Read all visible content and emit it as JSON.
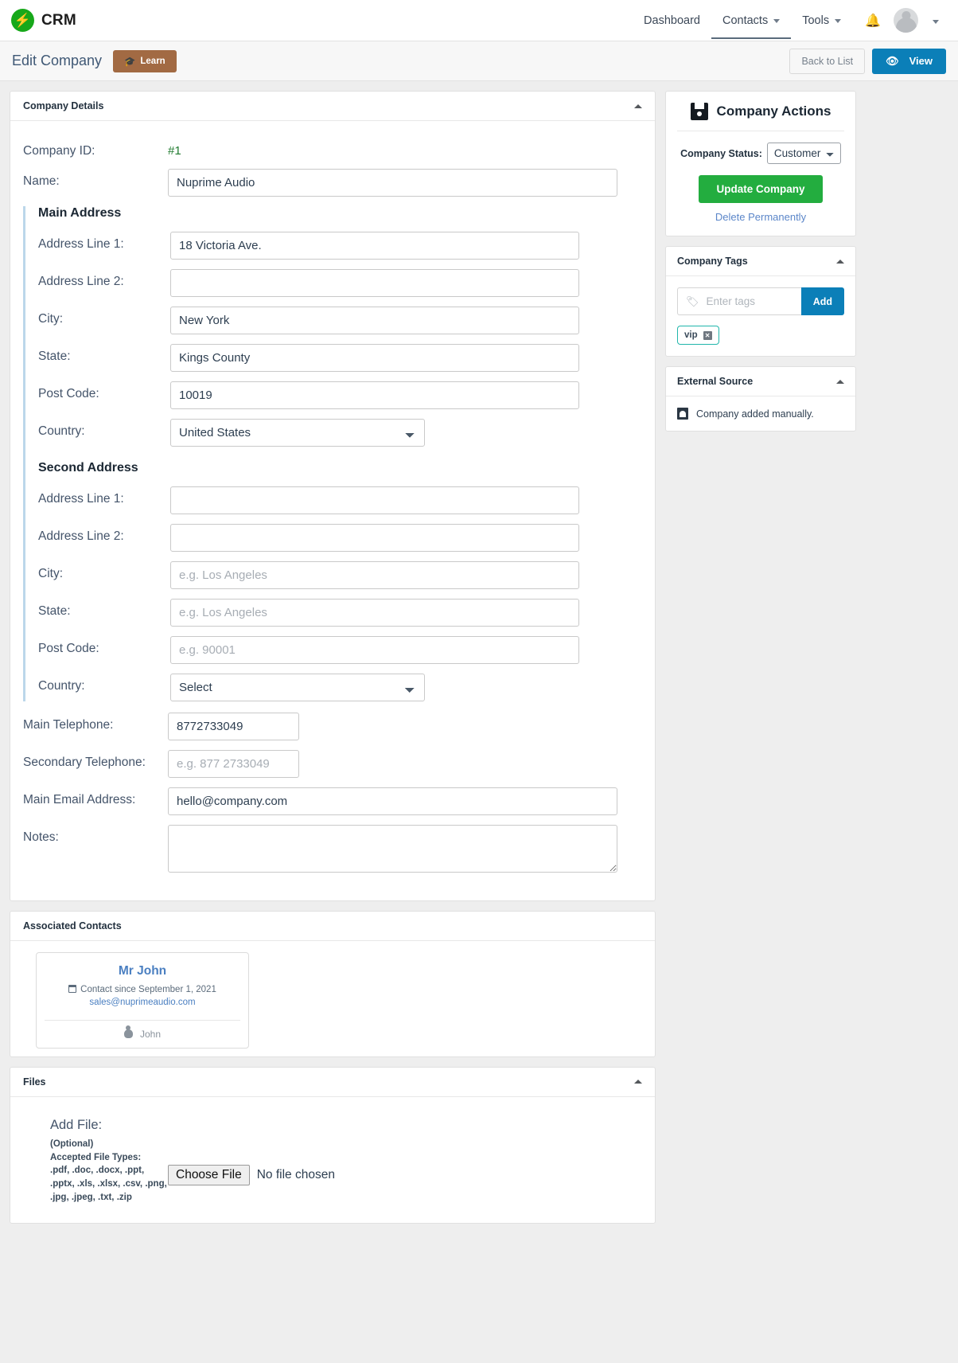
{
  "navbar": {
    "brand": "CRM",
    "brand_icon": "bolt-icon",
    "links": [
      {
        "label": "Dashboard",
        "has_caret": false,
        "active": false
      },
      {
        "label": "Contacts",
        "has_caret": true,
        "active": true
      },
      {
        "label": "Tools",
        "has_caret": true,
        "active": false
      }
    ],
    "bell_icon": "bell-icon",
    "avatar_icon": "user-avatar-icon"
  },
  "subheader": {
    "title": "Edit Company",
    "learn_label": "Learn",
    "learn_icon": "graduation-cap-icon",
    "back_label": "Back to List",
    "view_label": "View",
    "view_icon": "eye-icon"
  },
  "company_details": {
    "panel_title": "Company Details",
    "company_id_label": "Company ID:",
    "company_id_value": "#1",
    "name_label": "Name:",
    "name_value": "Nuprime Audio",
    "main_address": {
      "title": "Main Address",
      "address1_label": "Address Line 1:",
      "address1_value": "18 Victoria Ave.",
      "address2_label": "Address Line 2:",
      "address2_value": "",
      "city_label": "City:",
      "city_value": "New York",
      "state_label": "State:",
      "state_value": "Kings County",
      "postcode_label": "Post Code:",
      "postcode_value": "10019",
      "country_label": "Country:",
      "country_value": "United States"
    },
    "second_address": {
      "title": "Second Address",
      "address1_label": "Address Line 1:",
      "address1_value": "",
      "address2_label": "Address Line 2:",
      "address2_value": "",
      "city_label": "City:",
      "city_placeholder": "e.g. Los Angeles",
      "state_label": "State:",
      "state_placeholder": "e.g. Los Angeles",
      "postcode_label": "Post Code:",
      "postcode_placeholder": "e.g. 90001",
      "country_label": "Country:",
      "country_value": "Select"
    },
    "main_tel_label": "Main Telephone:",
    "main_tel_value": "8772733049",
    "secondary_tel_label": "Secondary Telephone:",
    "secondary_tel_placeholder": "e.g. 877 2733049",
    "main_email_label": "Main Email Address:",
    "main_email_value": "hello@company.com",
    "notes_label": "Notes:",
    "notes_value": ""
  },
  "associated_contacts": {
    "panel_title": "Associated Contacts",
    "contacts": [
      {
        "name": "Mr John",
        "since": "Contact since September 1, 2021",
        "email": "sales@nuprimeaudio.com",
        "owner": "John"
      }
    ]
  },
  "files": {
    "panel_title": "Files",
    "add_file_label": "Add File:",
    "optional_label": "(Optional)",
    "accepted_label": "Accepted File Types:",
    "accepted_line1": ".pdf, .doc, .docx, .ppt,",
    "accepted_line2": ".pptx, .xls, .xlsx, .csv, .png,",
    "accepted_line3": ".jpg, .jpeg, .txt, .zip",
    "choose_file_label": "Choose File",
    "no_file_label": "No file chosen"
  },
  "sidebar": {
    "actions": {
      "title": "Company Actions",
      "icon": "floppy-save-icon",
      "status_label": "Company Status:",
      "status_value": "Customer",
      "update_label": "Update Company",
      "delete_label": "Delete Permanently"
    },
    "tags": {
      "title": "Company Tags",
      "placeholder": "Enter tags",
      "tag_icon": "tag-icon",
      "add_label": "Add",
      "chips": [
        {
          "label": "vip",
          "remove_icon": "close-icon"
        }
      ]
    },
    "external_source": {
      "title": "External Source",
      "icon": "database-icon",
      "text": "Company added manually."
    }
  },
  "colors": {
    "brand_green": "#17a81a",
    "accent_blue": "#0b7fb8",
    "update_green": "#23ad3f",
    "learn_brown": "#a26a43",
    "tag_teal": "#21b6ab",
    "id_green": "#1f7a2e"
  }
}
